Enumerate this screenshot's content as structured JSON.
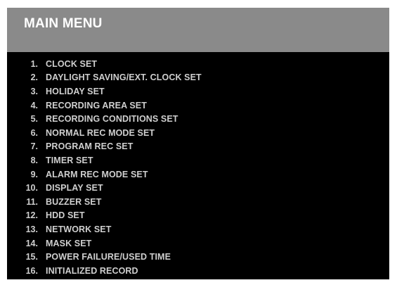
{
  "window": {
    "title": "MAIN MENU"
  },
  "colors": {
    "title_bar": "#8a8a8a",
    "background": "#000000",
    "title_text": "#ffffff",
    "item_text": "#cfcfcf"
  },
  "menu": {
    "items": [
      {
        "number": "1.",
        "label": "CLOCK SET"
      },
      {
        "number": "2.",
        "label": "DAYLIGHT SAVING/EXT. CLOCK SET"
      },
      {
        "number": "3.",
        "label": "HOLIDAY SET"
      },
      {
        "number": "4.",
        "label": "RECORDING AREA SET"
      },
      {
        "number": "5.",
        "label": "RECORDING CONDITIONS SET"
      },
      {
        "number": "6.",
        "label": "NORMAL REC MODE SET"
      },
      {
        "number": "7.",
        "label": "PROGRAM REC SET"
      },
      {
        "number": "8.",
        "label": "TIMER SET"
      },
      {
        "number": "9.",
        "label": "ALARM REC MODE SET"
      },
      {
        "number": "10.",
        "label": "DISPLAY SET"
      },
      {
        "number": "11.",
        "label": "BUZZER SET"
      },
      {
        "number": "12.",
        "label": "HDD SET"
      },
      {
        "number": "13.",
        "label": "NETWORK SET"
      },
      {
        "number": "14.",
        "label": "MASK SET"
      },
      {
        "number": "15.",
        "label": "POWER FAILURE/USED TIME"
      },
      {
        "number": "16.",
        "label": "INITIALIZED RECORD"
      }
    ]
  }
}
